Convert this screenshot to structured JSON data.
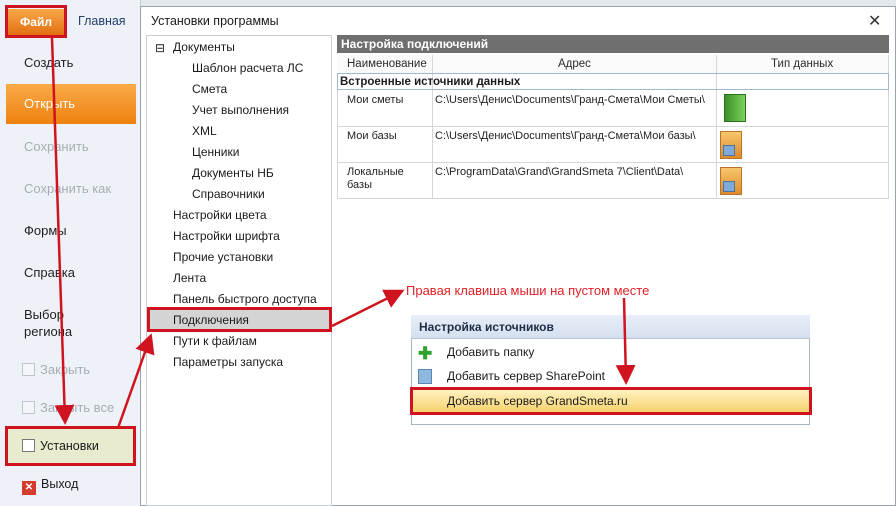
{
  "ribbon": {
    "file_tab": "Файл",
    "home_tab": "Главная"
  },
  "backstage": {
    "create": "Создать",
    "open": "Открыть",
    "save": "Сохранить",
    "save_as": "Сохранить как",
    "forms": "Формы",
    "help": "Справка",
    "region_line1": "Выбор",
    "region_line2": "региона",
    "close": "Закрыть",
    "close_all": "Закрыть все",
    "settings": "Установки",
    "exit": "Выход"
  },
  "dialog": {
    "title": "Установки программы",
    "close_glyph": "✕"
  },
  "tree": {
    "expander": "⊟",
    "documents": "Документы",
    "children": [
      "Шаблон расчета ЛС",
      "Смета",
      "Учет выполнения",
      "XML",
      "Ценники",
      "Документы НБ",
      "Справочники"
    ],
    "items": [
      "Настройки цвета",
      "Настройки шрифта",
      "Прочие установки",
      "Лента",
      "Панель быстрого доступа",
      "Подключения",
      "Пути к файлам",
      "Параметры запуска"
    ]
  },
  "panel": {
    "header": "Настройка подключений",
    "columns": {
      "name": "Наименование",
      "address": "Адрес",
      "type": "Тип данных"
    },
    "group": "Встроенные источники данных",
    "rows": [
      {
        "name": "Мои сметы",
        "address": "C:\\Users\\Денис\\Documents\\Гранд-Смета\\Мои Сметы\\",
        "icon": "green-binder-icon"
      },
      {
        "name": "Мои базы",
        "address": "C:\\Users\\Денис\\Documents\\Гранд-Смета\\Мои базы\\",
        "icon": "orange-database-icon"
      },
      {
        "name_line1": "Локальные",
        "name_line2": "базы",
        "address": "C:\\ProgramData\\Grand\\GrandSmeta 7\\Client\\Data\\",
        "icon": "orange-database-icon"
      }
    ]
  },
  "context_menu": {
    "title": "Настройка источников",
    "items": [
      "Добавить папку",
      "Добавить сервер SharePoint",
      "Добавить сервер GrandSmeta.ru"
    ]
  },
  "annotation": {
    "text": "Правая клавиша мыши на пустом месте",
    "color": "#e21f26"
  },
  "colors": {
    "accent_orange": "#ee8110",
    "annotation_red": "#d0141f",
    "highlight": "#f6d36e"
  }
}
